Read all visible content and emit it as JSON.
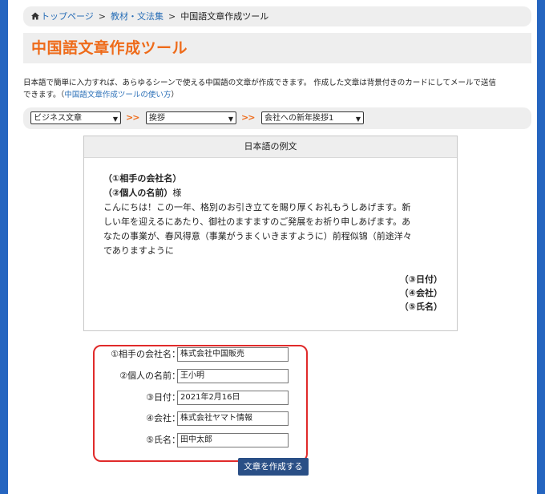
{
  "breadcrumb": {
    "home": "トップページ",
    "sep": ">",
    "item2": "教材・文法集",
    "current": "中国語文章作成ツール"
  },
  "title": "中国語文章作成ツール",
  "intro": {
    "line1": "日本語で簡単に入力すれば、あらゆるシーンで使える中国語の文章が作成できます。 作成した文章は背景付きのカードにしてメールで送信",
    "line2_prefix": "できます。（",
    "link": "中国語文章作成ツールの使い方",
    "line2_suffix": "）"
  },
  "selects": {
    "category": "ビジネス文章",
    "type": "挨拶",
    "template": "会社への新年挨拶1",
    "arrow": ">>"
  },
  "example": {
    "heading": "日本語の例文",
    "recipient_company": "（①相手の会社名）",
    "recipient_name": "（②個人の名前）",
    "honorific": "様",
    "body_lines": [
      "こんにちは！この一年、格別のお引き立てを賜り厚くお礼もうしあげます。新",
      "しい年を迎えるにあたり、御社のますますのご発展をお祈り申しあげます。あ",
      "なたの事業が、春风得意（事業がうまくいきますように）前程似锦（前途洋々",
      "でありますように"
    ],
    "date": "（③日付）",
    "company": "（④会社）",
    "name": "（⑤氏名）"
  },
  "form": {
    "rows": [
      {
        "label": "①相手の会社名：",
        "value": "株式会社中国販売"
      },
      {
        "label": "②個人の名前：",
        "value": "王小明"
      },
      {
        "label": "③日付：",
        "value": "2021年2月16日"
      },
      {
        "label": "④会社：",
        "value": "株式会社ヤマト情報"
      },
      {
        "label": "⑤氏名：",
        "value": "田中太郎"
      }
    ],
    "submit": "文章を作成する"
  },
  "colors": {
    "accent": "#ee6b1a",
    "link": "#2a6fb7",
    "button": "#2a4f86",
    "annotation": "#e02a2a",
    "frame": "#2565c0"
  }
}
